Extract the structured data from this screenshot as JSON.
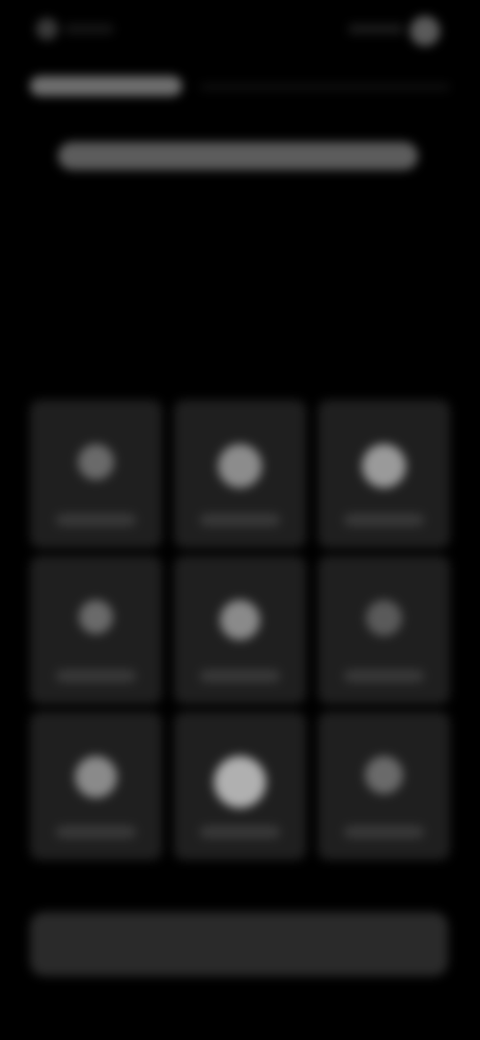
{
  "status_bar": {
    "left_icon": "status-dot-icon",
    "right_icon": "profile-icon"
  },
  "header": {
    "title": "",
    "subtitle": ""
  },
  "grid": {
    "tiles": [
      {
        "icon": "app-icon",
        "label": "",
        "icon_shade": "#6a6a6a"
      },
      {
        "icon": "app-icon",
        "label": "",
        "icon_shade": "#8c8c8c"
      },
      {
        "icon": "app-icon",
        "label": "",
        "icon_shade": "#9a9a9a"
      },
      {
        "icon": "app-icon",
        "label": "",
        "icon_shade": "#6a6a6a"
      },
      {
        "icon": "app-icon",
        "label": "",
        "icon_shade": "#8a8a8a"
      },
      {
        "icon": "app-icon",
        "label": "",
        "icon_shade": "#5a5a5a"
      },
      {
        "icon": "app-icon",
        "label": "",
        "icon_shade": "#8a8a8a"
      },
      {
        "icon": "app-icon",
        "label": "",
        "icon_shade": "#b0b0b0"
      },
      {
        "icon": "app-icon",
        "label": "",
        "icon_shade": "#6a6a6a"
      }
    ]
  },
  "bottom_bar": {
    "label": ""
  },
  "colors": {
    "background": "#000000",
    "tile": "#1f1f1f",
    "bottom_bar": "#2a2a2a"
  }
}
